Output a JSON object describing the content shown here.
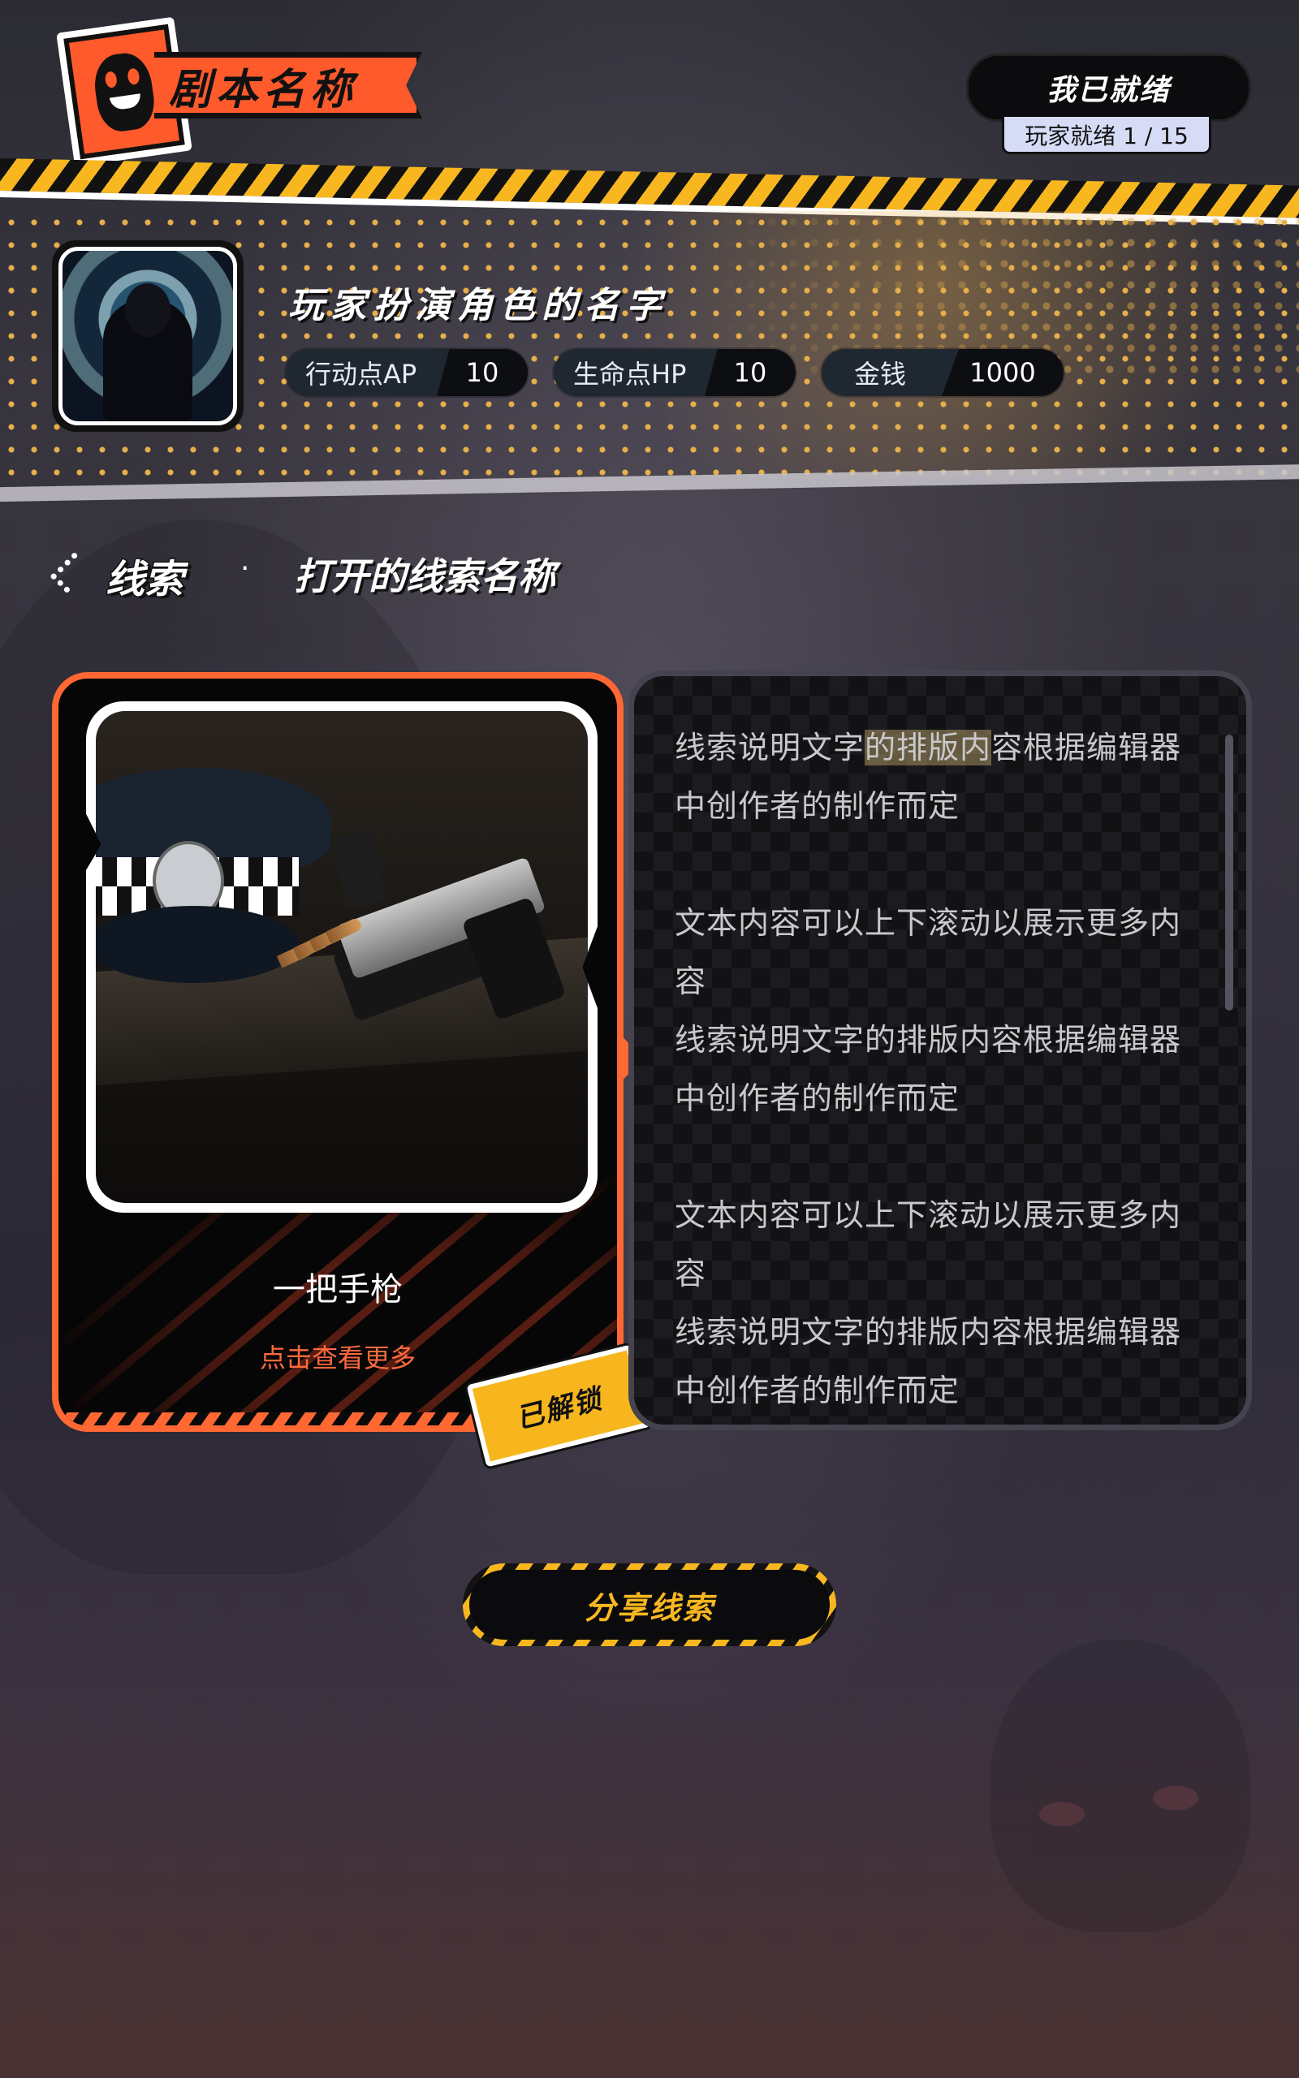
{
  "header": {
    "script_title": "剧本名称",
    "ready_button_label": "我已就绪",
    "ready_status": "玩家就绪 1 / 15"
  },
  "player": {
    "character_name": "玩家扮演角色的名字",
    "stats": [
      {
        "label": "行动点AP",
        "value": "10"
      },
      {
        "label": "生命点HP",
        "value": "10"
      },
      {
        "label": "金钱",
        "value": "1000"
      }
    ]
  },
  "breadcrumb": {
    "section": "线索",
    "separator": "·",
    "title": "打开的线索名称"
  },
  "clue": {
    "name": "一把手枪",
    "view_more": "点击查看更多",
    "status_badge": "已解锁",
    "image_icon": "pistol-and-police-cap-image",
    "description": {
      "p1_before": "线索说明文字",
      "p1_highlight": "的排版内",
      "p1_after": "容根据编辑器中创作者的制作而定",
      "p2": "文本内容可以上下滚动以展示更多内容",
      "p3": "线索说明文字的排版内容根据编辑器中创作者的制作而定",
      "p4": "文本内容可以上下滚动以展示更多内容",
      "p5": "线索说明文字的排版内容根据编辑器中创作者的制作而定"
    }
  },
  "actions": {
    "share_label": "分享线索"
  },
  "colors": {
    "accent_orange": "#ff6733",
    "hazard_yellow": "#f8b71f",
    "ready_badge": "#d6dcf5"
  }
}
